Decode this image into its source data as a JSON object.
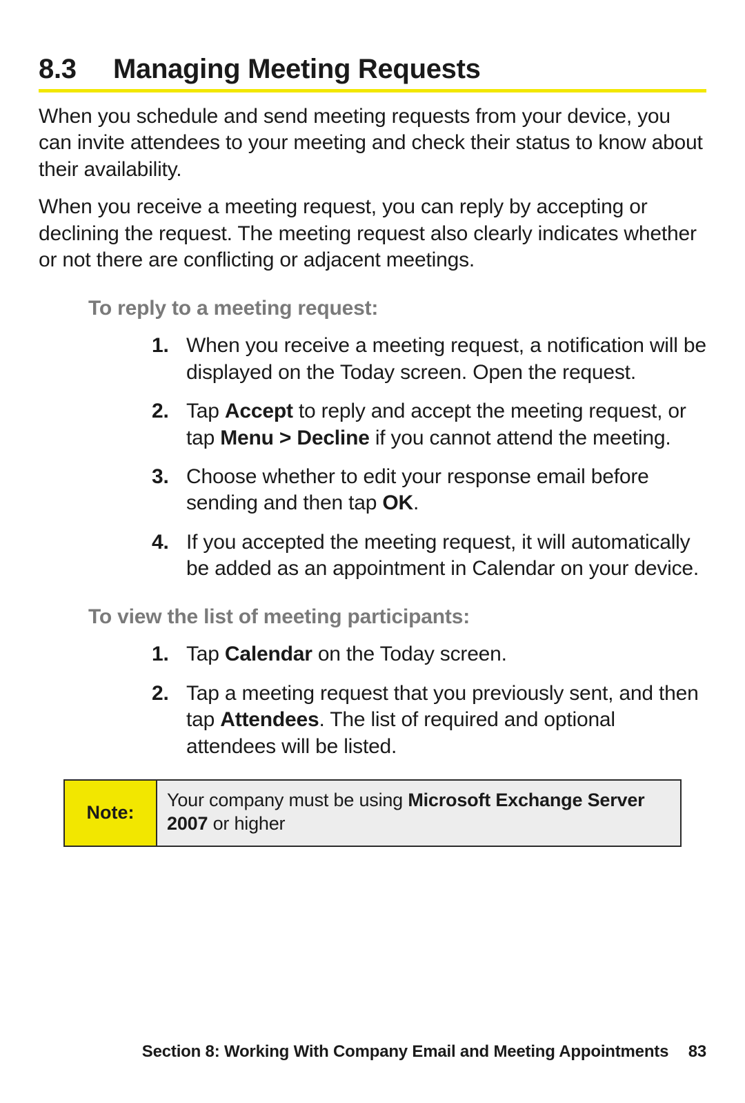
{
  "heading": {
    "number": "8.3",
    "title": "Managing Meeting Requests"
  },
  "intro_paras": [
    "When you schedule and send meeting requests from your device, you can invite attendees to your meeting and check their status to know about their availability.",
    "When you receive a meeting request, you can reply by accepting or declining the request. The meeting request also clearly indicates whether or not there are conflicting or adjacent meetings."
  ],
  "section_a": {
    "subhead": "To reply to a meeting request:",
    "steps": [
      {
        "n": "1.",
        "runs": [
          {
            "t": "When you receive a meeting request, a notification will be displayed on the Today screen. Open the request."
          }
        ]
      },
      {
        "n": "2.",
        "runs": [
          {
            "t": "Tap "
          },
          {
            "t": "Accept",
            "b": true
          },
          {
            "t": " to reply and accept the meeting request, or tap "
          },
          {
            "t": "Menu > Decline",
            "b": true
          },
          {
            "t": " if you cannot attend the meeting."
          }
        ]
      },
      {
        "n": "3.",
        "runs": [
          {
            "t": "Choose whether to edit your response email before sending and then tap "
          },
          {
            "t": "OK",
            "b": true
          },
          {
            "t": "."
          }
        ]
      },
      {
        "n": "4.",
        "runs": [
          {
            "t": "If you accepted the meeting request, it will automatically be added as an appointment in Calendar on your device."
          }
        ]
      }
    ]
  },
  "section_b": {
    "subhead": "To view the list of meeting participants:",
    "steps": [
      {
        "n": "1.",
        "runs": [
          {
            "t": "Tap "
          },
          {
            "t": "Calendar",
            "b": true
          },
          {
            "t": " on the Today screen."
          }
        ]
      },
      {
        "n": "2.",
        "runs": [
          {
            "t": "Tap a meeting request that you previously sent, and then tap "
          },
          {
            "t": "Attendees",
            "b": true
          },
          {
            "t": ". The list of required and optional attendees will be listed."
          }
        ]
      }
    ]
  },
  "note": {
    "label": "Note:",
    "runs": [
      {
        "t": "Your company must be using "
      },
      {
        "t": "Microsoft Exchange Server 2007",
        "b": true
      },
      {
        "t": " or higher"
      }
    ]
  },
  "footer": {
    "section_label": "Section 8: Working With Company Email and Meeting Appointments",
    "page": "83"
  }
}
